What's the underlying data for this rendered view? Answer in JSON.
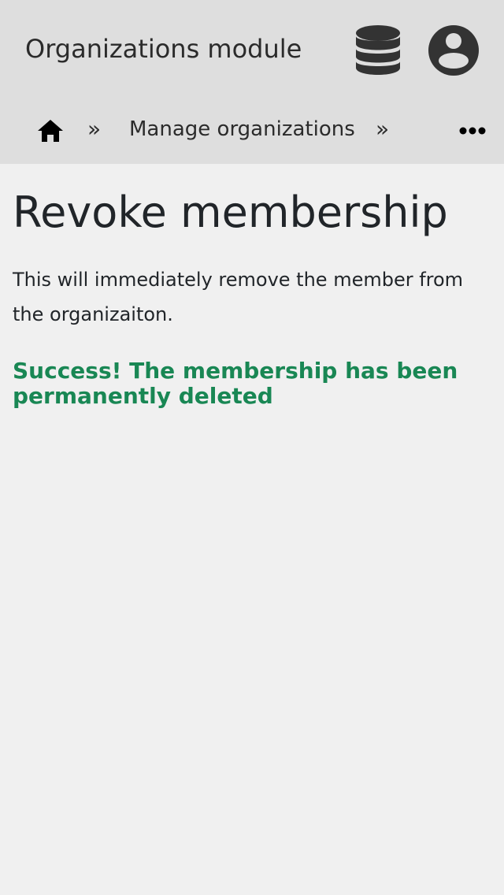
{
  "header": {
    "title": "Organizations module",
    "database_icon": "database-icon",
    "account_icon": "account-circle-icon"
  },
  "breadcrumb": {
    "home_icon": "home-icon",
    "separator": "»",
    "items": [
      {
        "label": "Manage organizations"
      }
    ],
    "more_icon": "more-horizontal-icon"
  },
  "main": {
    "title": "Revoke membership",
    "description": "This will immediately remove the member from the organizaiton.",
    "success_message": "Success! The membership has been permanently deleted"
  },
  "colors": {
    "header_bg": "#dedede",
    "page_bg": "#f0f0f0",
    "success": "#198754",
    "icon": "#333333"
  }
}
